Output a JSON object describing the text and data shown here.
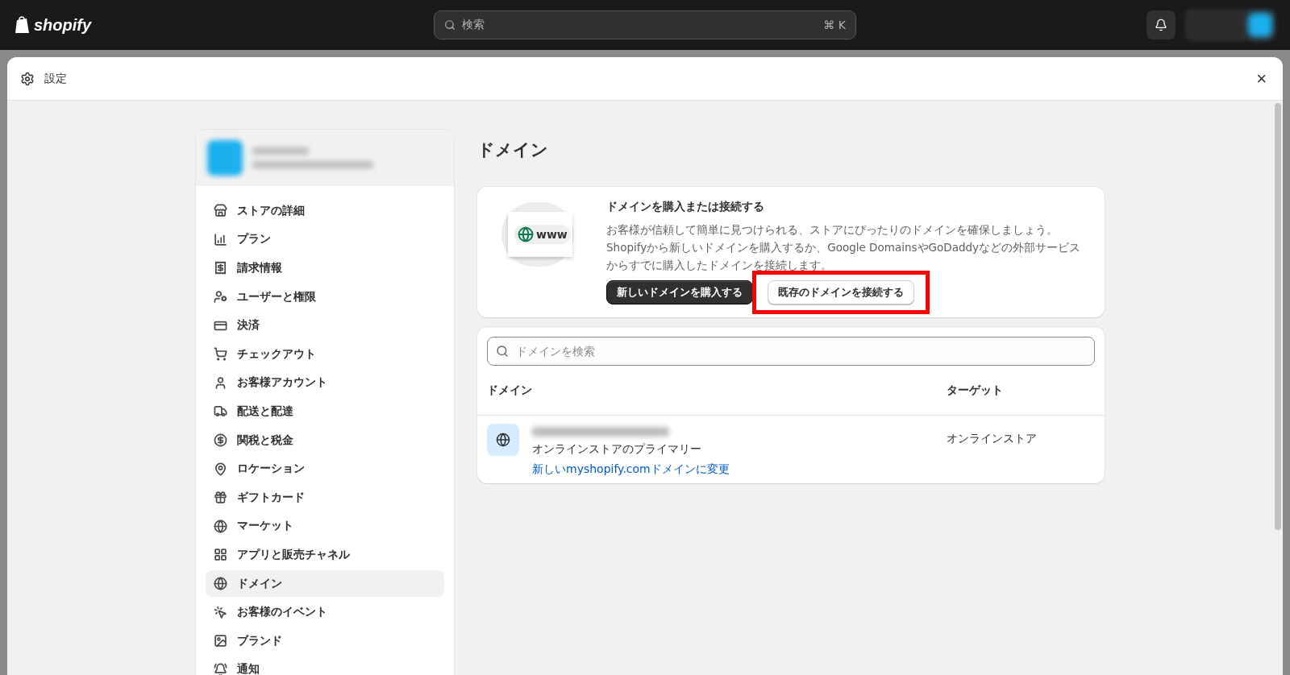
{
  "topbar": {
    "logo": "shopify",
    "search": {
      "placeholder": "検索",
      "shortcut": "⌘ K"
    }
  },
  "window": {
    "title": "設定",
    "close": "×"
  },
  "sidebar": {
    "items": [
      {
        "label": "ストアの詳細",
        "selected": false
      },
      {
        "label": "プラン",
        "selected": false
      },
      {
        "label": "請求情報",
        "selected": false
      },
      {
        "label": "ユーザーと権限",
        "selected": false
      },
      {
        "label": "決済",
        "selected": false
      },
      {
        "label": "チェックアウト",
        "selected": false
      },
      {
        "label": "お客様アカウント",
        "selected": false
      },
      {
        "label": "配送と配達",
        "selected": false
      },
      {
        "label": "関税と税金",
        "selected": false
      },
      {
        "label": "ロケーション",
        "selected": false
      },
      {
        "label": "ギフトカード",
        "selected": false
      },
      {
        "label": "マーケット",
        "selected": false
      },
      {
        "label": "アプリと販売チャネル",
        "selected": false
      },
      {
        "label": "ドメイン",
        "selected": true
      },
      {
        "label": "お客様のイベント",
        "selected": false
      },
      {
        "label": "ブランド",
        "selected": false
      },
      {
        "label": "通知",
        "selected": false
      }
    ]
  },
  "page": {
    "title": "ドメイン",
    "promo": {
      "illustration_text": "www",
      "title": "ドメインを購入または接続する",
      "body": "お客様が信頼して簡単に見つけられる、ストアにぴったりのドメインを確保しましょう。Shopifyから新しいドメインを購入するか、Google DomainsやGoDaddyなどの外部サービスからすでに購入したドメインを接続します。",
      "buttons": [
        {
          "label": "新しいドメインを購入する",
          "kind": "primary",
          "highlighted": false
        },
        {
          "label": "既存のドメインを接続する",
          "kind": "secondary",
          "highlighted": true
        }
      ]
    },
    "domains": {
      "search": {
        "placeholder": "ドメインを検索"
      },
      "columns": [
        "ドメイン",
        "ターゲット"
      ],
      "rows": [
        {
          "description": "オンラインストアのプライマリー",
          "link": "新しいmyshopify.comドメインに変更",
          "target": "オンラインストア"
        }
      ]
    }
  }
}
